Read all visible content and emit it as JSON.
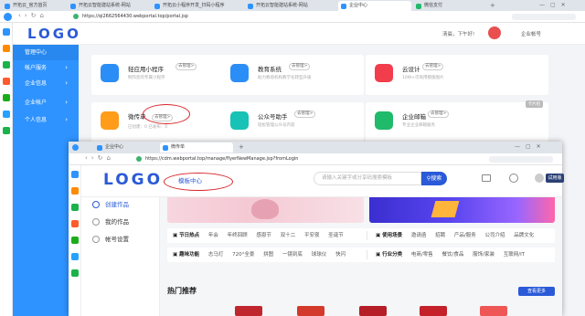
{
  "back_browser": {
    "tabs": [
      "开拓云_官方首页",
      "开拓云智能建站系统-网站",
      "开拓云小程序开发_扫码小程序",
      "开拓云智能建站系统-网站",
      "企业中心",
      "微信支付"
    ],
    "url": "https://qi2662564430.webportal.top/portal.jsp",
    "logo": "LOGO",
    "greeting": "清晨，下午好!",
    "user_menu": "企业帐号",
    "sidebar": [
      {
        "label": "管理中心"
      },
      {
        "label": "帐户服务",
        "chev": "›"
      },
      {
        "label": "企业信息",
        "chev": "›"
      },
      {
        "label": "企业帐户",
        "chev": "›"
      },
      {
        "label": "个人信息",
        "chev": "›"
      }
    ],
    "cards": [
      {
        "title": "轻应用小程序",
        "badge": "去管理>",
        "desc": "制作您的专属小程序",
        "color": "#2b8df6"
      },
      {
        "title": "教育系统",
        "badge": "去管理>",
        "desc": "助力教培机构教学化转型升级",
        "color": "#2b8df6"
      },
      {
        "title": "云设计",
        "badge": "去管理>",
        "desc": "10W+可商用模版图片",
        "color": "#f23d4c"
      },
      {
        "title": "微传单",
        "badge": "去管理>",
        "desc": "已创建：0   已发布：0",
        "color": "#ff9c1a"
      },
      {
        "title": "公众号助手",
        "badge": "去管理>",
        "desc": "轻松管理公众号内容",
        "color": "#18c2b6"
      },
      {
        "title": "企业邮箱",
        "badge": "去管理>",
        "desc": "专业企业邮箱服务",
        "color": "#1fba6a"
      }
    ],
    "corner_tag": "卡片组"
  },
  "front_browser": {
    "tabs": [
      "企业中心",
      "微传单"
    ],
    "url": "https://cdm.webportal.top/manage/flyerNewManage.jsp?fromLogin",
    "logo": "LOGO",
    "nav_title": "模板中心",
    "search_placeholder": "请输入关键字或分享码搜索模板",
    "search_button": "搜索",
    "trial_button": "试用版",
    "sidebar": [
      {
        "label": "创建作品"
      },
      {
        "label": "我的作品"
      },
      {
        "label": "帐号设置"
      }
    ],
    "tag_rows": [
      [
        {
          "title": "节日热点",
          "tags": [
            "年会",
            "年终回顾",
            "感恩节",
            "双十二",
            "平安夜",
            "圣诞节"
          ]
        },
        {
          "title": "使用场景",
          "tags": [
            "邀请函",
            "招聘",
            "产品/服务",
            "公司介绍",
            "品牌文化"
          ]
        }
      ],
      [
        {
          "title": "趣味功能",
          "tags": [
            "志马灯",
            "720°全景",
            "拼图",
            "一镜到底",
            "球球仪",
            "快闪"
          ]
        },
        {
          "title": "行业分类",
          "tags": [
            "电商/零售",
            "餐饮/食品",
            "服饰/家装",
            "互联网/IT"
          ]
        }
      ]
    ],
    "section_title": "热门推荐",
    "more_button": "查看更多"
  }
}
